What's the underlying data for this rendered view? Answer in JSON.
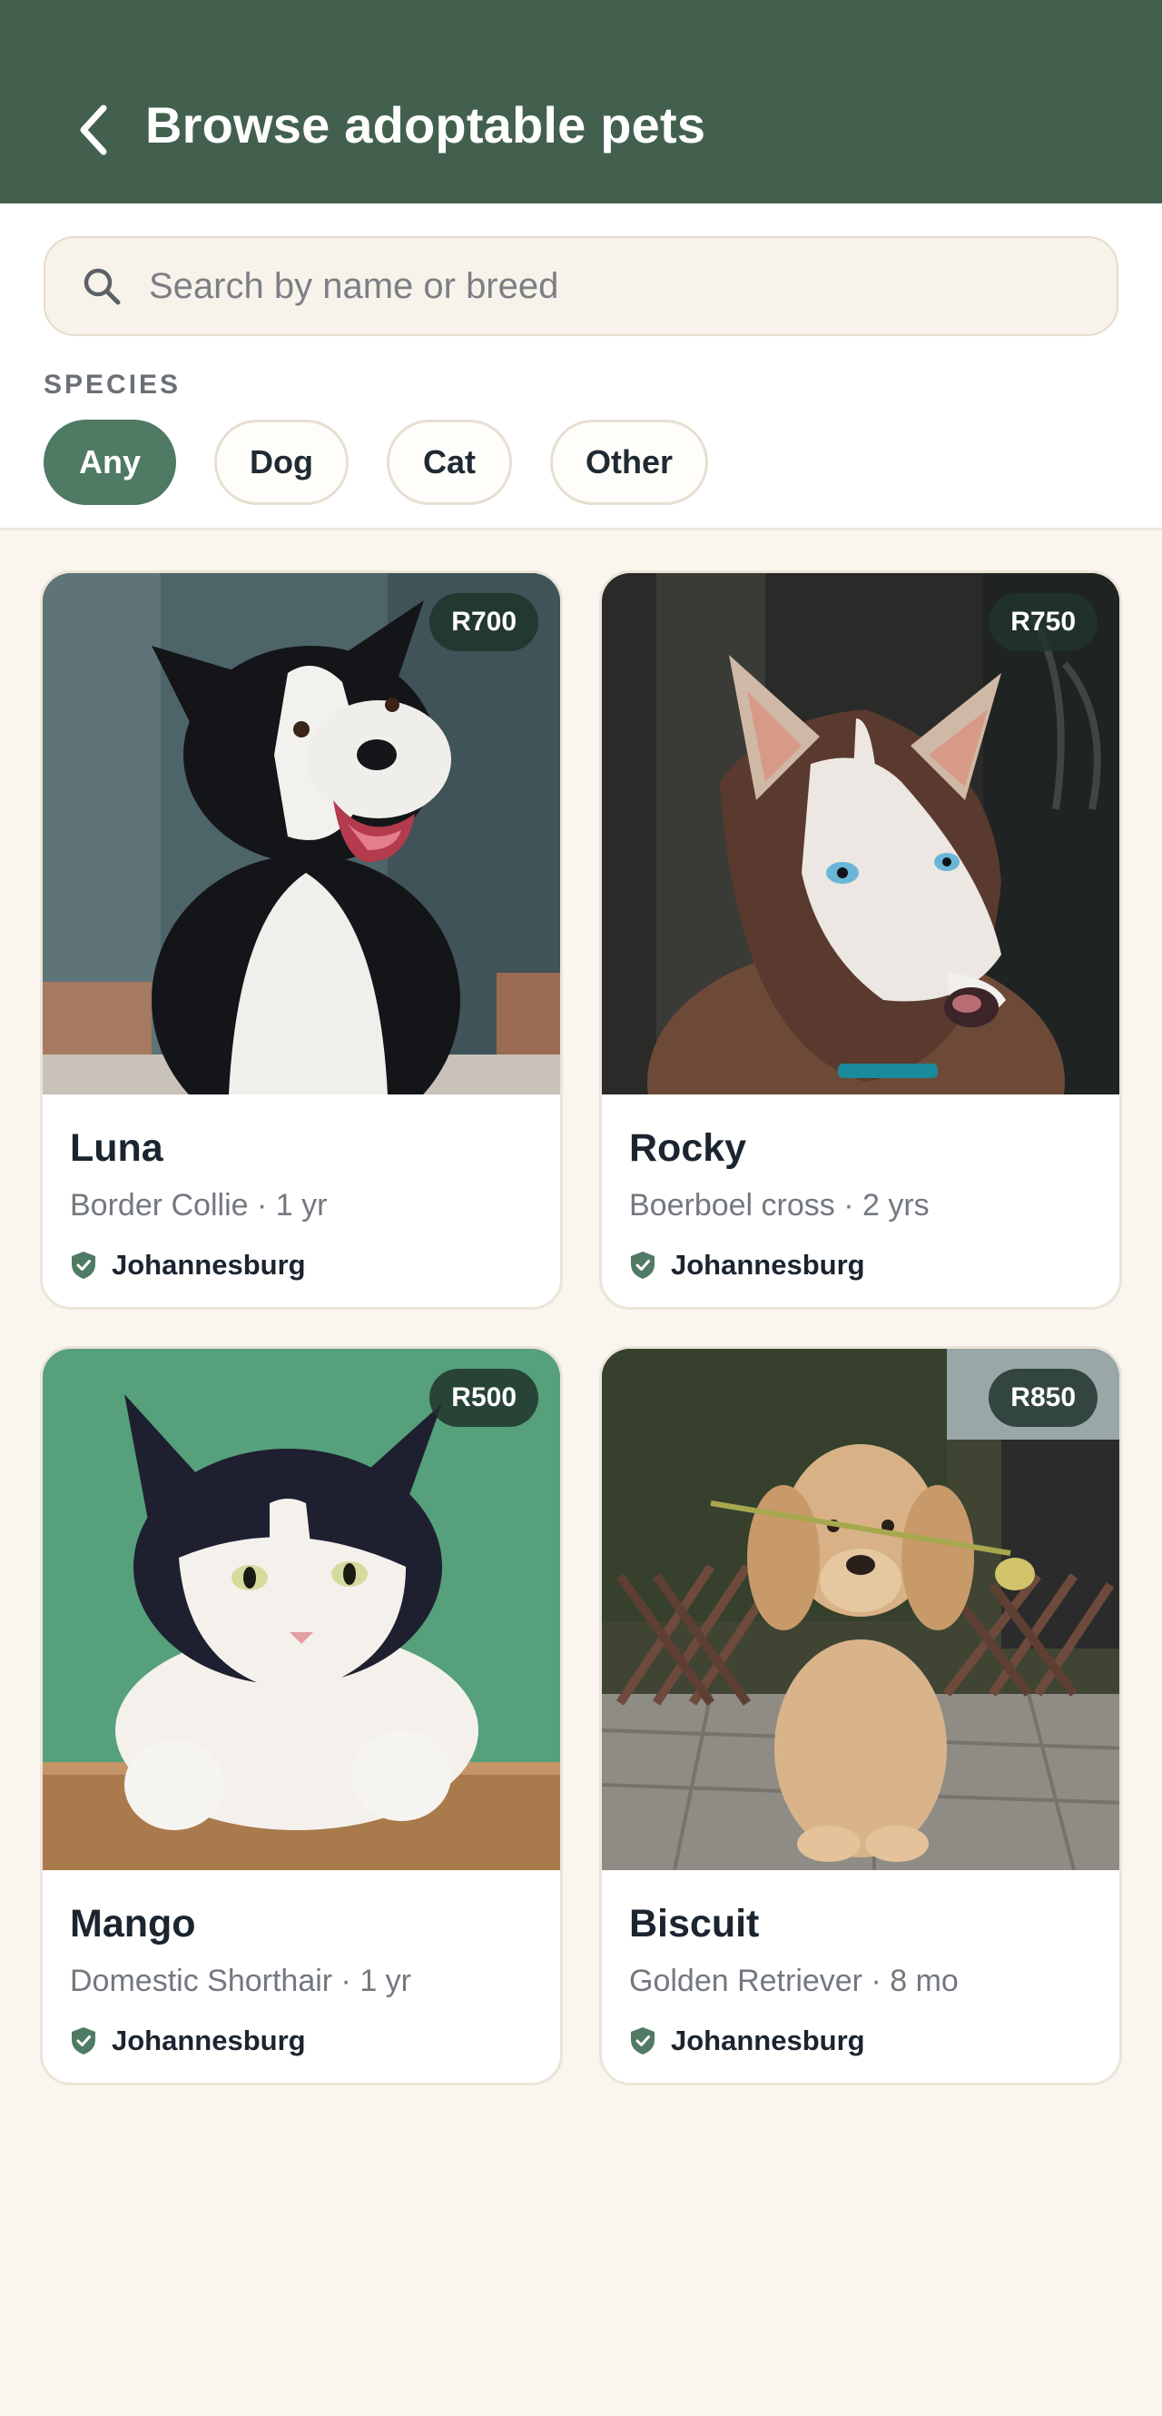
{
  "appbar": {
    "title": "Browse adoptable pets",
    "back_icon": "chevron-left-icon"
  },
  "search": {
    "placeholder": "Search by name or breed",
    "value": "",
    "icon": "search-icon"
  },
  "filters": {
    "species_label": "SPECIES",
    "chips": [
      {
        "label": "Any",
        "selected": true
      },
      {
        "label": "Dog",
        "selected": false
      },
      {
        "label": "Cat",
        "selected": false
      },
      {
        "label": "Other",
        "selected": false
      }
    ]
  },
  "pets": [
    {
      "name": "Luna",
      "meta": "Border Collie · 1 yr",
      "location": "Johannesburg",
      "price": "R700"
    },
    {
      "name": "Rocky",
      "meta": "Boerboel cross · 2 yrs",
      "location": "Johannesburg",
      "price": "R750"
    },
    {
      "name": "Mango",
      "meta": "Domestic Shorthair · 1 yr",
      "location": "Johannesburg",
      "price": "R500"
    },
    {
      "name": "Biscuit",
      "meta": "Golden Retriever · 8 mo",
      "location": "Johannesburg",
      "price": "R850"
    }
  ],
  "colors": {
    "appbar": "#43604f",
    "accent": "#4f7a63",
    "background": "#faf6ef"
  }
}
